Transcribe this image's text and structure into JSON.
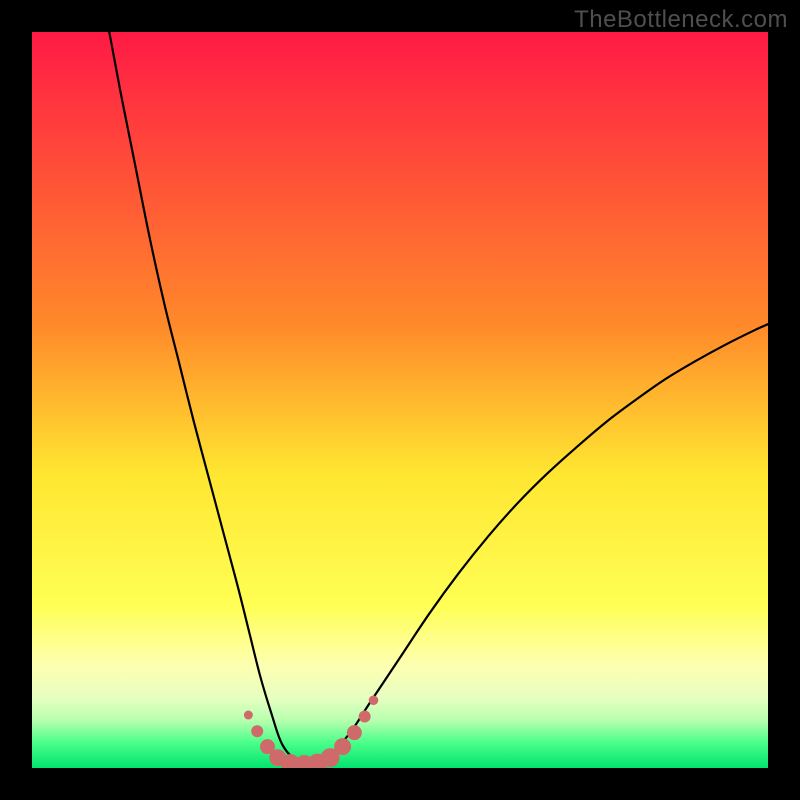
{
  "watermark": "TheBottleneck.com",
  "colors": {
    "frame": "#000000",
    "curve": "#000000",
    "marker": "#cf6a6b",
    "marker_stroke": "#cf6a6b"
  },
  "gradient_stops": [
    {
      "offset": 0.0,
      "color": "#ff1a45"
    },
    {
      "offset": 0.4,
      "color": "#ff8a2a"
    },
    {
      "offset": 0.6,
      "color": "#ffe631"
    },
    {
      "offset": 0.78,
      "color": "#ffff55"
    },
    {
      "offset": 0.86,
      "color": "#fdffb0"
    },
    {
      "offset": 0.905,
      "color": "#e6ffc0"
    },
    {
      "offset": 0.935,
      "color": "#b8ffb0"
    },
    {
      "offset": 0.965,
      "color": "#4dff8a"
    },
    {
      "offset": 1.0,
      "color": "#00e46e"
    }
  ],
  "chart_data": {
    "type": "line",
    "title": "",
    "xlabel": "",
    "ylabel": "",
    "xlim": [
      0,
      100
    ],
    "ylim": [
      0,
      100
    ],
    "series": [
      {
        "name": "bottleneck-curve",
        "x": [
          10.5,
          12,
          14,
          16,
          18,
          20,
          22,
          24,
          26,
          28,
          29.5,
          31,
          32.5,
          34,
          36,
          38,
          40,
          43,
          46,
          50,
          54,
          58,
          62,
          66,
          70,
          74,
          78,
          82,
          86,
          90,
          94,
          98,
          100
        ],
        "y": [
          100,
          92,
          82,
          72,
          63,
          55,
          47,
          39.5,
          32,
          24.5,
          18.5,
          12.5,
          7.5,
          3.2,
          1.0,
          0.5,
          1.4,
          4.5,
          9,
          15,
          21,
          26.5,
          31.5,
          36,
          40,
          43.6,
          47,
          50,
          52.8,
          55.2,
          57.4,
          59.4,
          60.3
        ]
      }
    ],
    "markers": {
      "name": "highlight-region",
      "points": [
        {
          "x": 29.4,
          "y": 7.2,
          "r": 4.5
        },
        {
          "x": 30.6,
          "y": 5.0,
          "r": 6.0
        },
        {
          "x": 32.0,
          "y": 2.9,
          "r": 7.5
        },
        {
          "x": 33.4,
          "y": 1.4,
          "r": 8.5
        },
        {
          "x": 35.1,
          "y": 0.6,
          "r": 9.5
        },
        {
          "x": 37.0,
          "y": 0.4,
          "r": 10.0
        },
        {
          "x": 38.8,
          "y": 0.6,
          "r": 10.0
        },
        {
          "x": 40.5,
          "y": 1.4,
          "r": 9.5
        },
        {
          "x": 42.2,
          "y": 2.9,
          "r": 8.5
        },
        {
          "x": 43.8,
          "y": 4.8,
          "r": 7.5
        },
        {
          "x": 45.2,
          "y": 7.0,
          "r": 6.0
        },
        {
          "x": 46.4,
          "y": 9.2,
          "r": 4.8
        }
      ]
    }
  }
}
